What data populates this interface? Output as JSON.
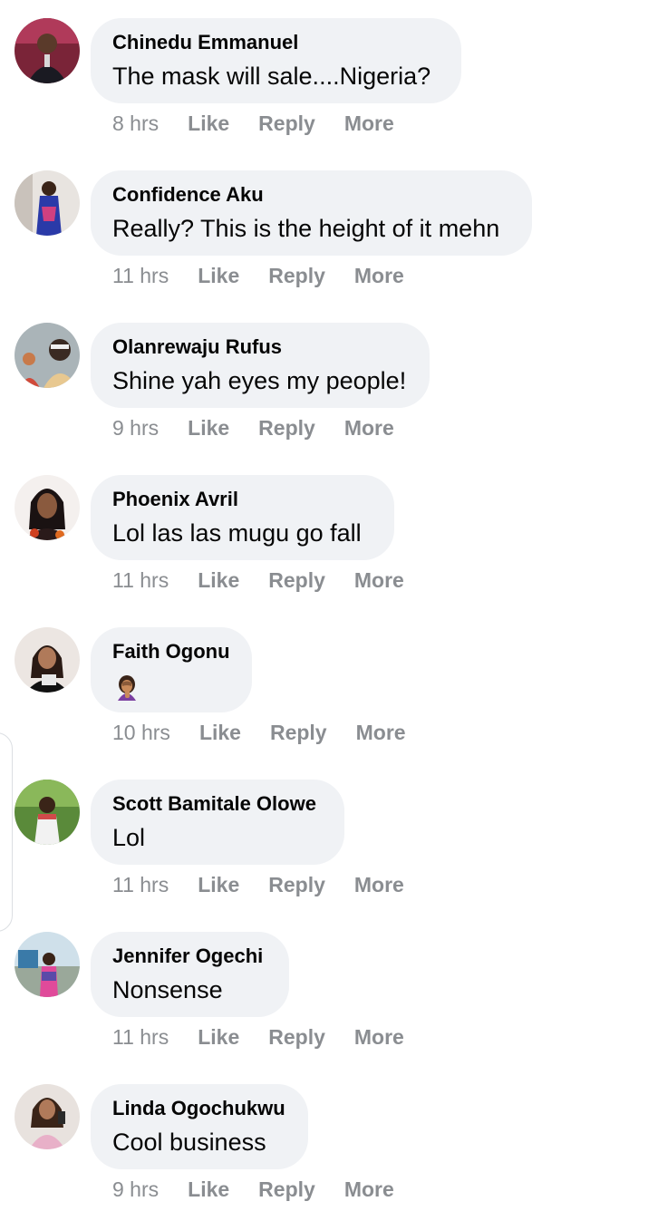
{
  "comments": [
    {
      "author": "Chinedu Emmanuel",
      "text": "The mask will sale....Nigeria?",
      "time": "8 hrs"
    },
    {
      "author": "Confidence Aku",
      "text": "Really? This is the height of it mehn",
      "time": "11 hrs"
    },
    {
      "author": "Olanrewaju Rufus",
      "text": "Shine yah eyes my people!",
      "time": "9 hrs"
    },
    {
      "author": "Phoenix Avril",
      "text": "Lol las las mugu go fall",
      "time": "11 hrs"
    },
    {
      "author": "Faith Ogonu",
      "text": "",
      "emoji": "woman-facepalming-emoji",
      "time": "10 hrs"
    },
    {
      "author": "Scott Bamitale Olowe",
      "text": "Lol",
      "time": "11 hrs"
    },
    {
      "author": "Jennifer Ogechi",
      "text": "Nonsense",
      "time": "11 hrs"
    },
    {
      "author": "Linda Ogochukwu",
      "text": "Cool business",
      "time": "9 hrs"
    }
  ],
  "actions": {
    "like_label": "Like",
    "reply_label": "Reply",
    "more_label": "More"
  },
  "colors": {
    "bubble": "#f0f2f5",
    "text": "#050505",
    "meta": "#8a8d91"
  }
}
